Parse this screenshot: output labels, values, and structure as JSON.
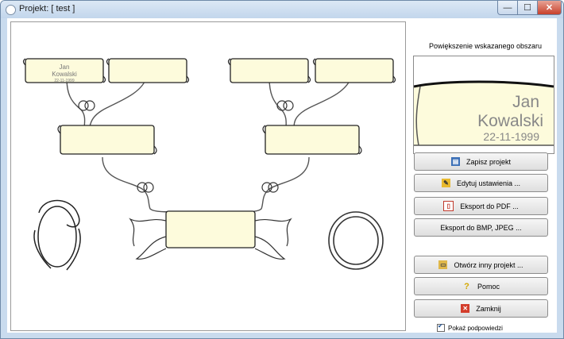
{
  "window": {
    "title": "Projekt: [ test ]"
  },
  "tree": {
    "person1": {
      "first": "Jan",
      "last": "Kowalski",
      "date": "22-11-1999"
    }
  },
  "preview": {
    "label": "Powiększenie wskazanego obszaru",
    "first": "Jan",
    "last": "Kowalski",
    "date": "22-11-1999"
  },
  "buttons": {
    "save": "Zapisz projekt",
    "settings": "Edytuj ustawienia ...",
    "pdf": "Eksport do PDF ...",
    "bmp": "Eksport do BMP, JPEG ...",
    "open": "Otwórz inny projekt ...",
    "help": "Pomoc",
    "close": "Zamknij"
  },
  "options": {
    "show_hints": "Pokaż podpowiedzi"
  },
  "colors": {
    "scroll_fill": "#fdfbdc",
    "titlebar": "#c9dbee"
  }
}
